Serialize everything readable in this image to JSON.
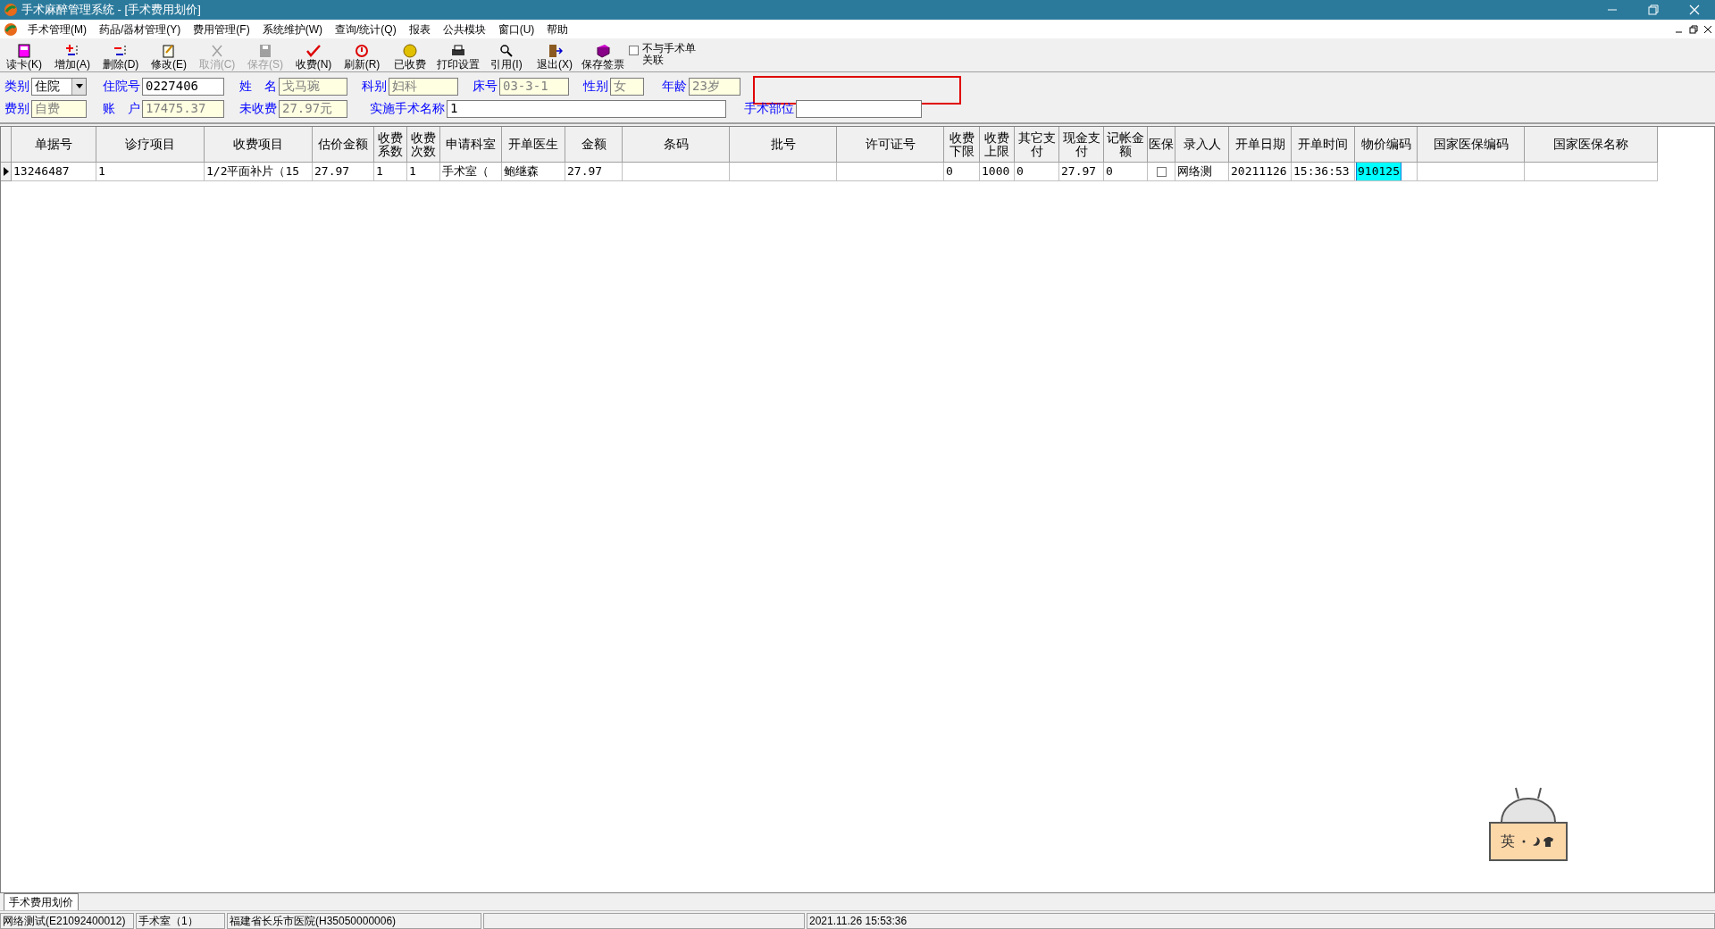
{
  "window": {
    "title": "手术麻醉管理系统 - [手术费用划价]"
  },
  "menu": [
    "手术管理(M)",
    "药品/器材管理(Y)",
    "费用管理(F)",
    "系统维护(W)",
    "查询/统计(Q)",
    "报表",
    "公共模块",
    "窗口(U)",
    "帮助"
  ],
  "toolbar": [
    {
      "label": "读卡(K)",
      "disabled": false
    },
    {
      "label": "增加(A)",
      "disabled": false
    },
    {
      "label": "删除(D)",
      "disabled": false
    },
    {
      "label": "修改(E)",
      "disabled": false
    },
    {
      "label": "取消(C)",
      "disabled": true
    },
    {
      "label": "保存(S)",
      "disabled": true
    },
    {
      "label": "收费(N)",
      "disabled": false
    },
    {
      "label": "刷新(R)",
      "disabled": false
    },
    {
      "label": "已收费",
      "disabled": false
    },
    {
      "label": "打印设置",
      "disabled": false
    },
    {
      "label": "引用(I)",
      "disabled": false
    },
    {
      "label": "退出(X)",
      "disabled": false
    },
    {
      "label": "保存签票",
      "disabled": false
    }
  ],
  "unlink_checkbox": {
    "label": "不与手术单关联",
    "checked": false
  },
  "form_row_1": [
    {
      "label": "类别",
      "value": "住院",
      "kind": "combo",
      "readonly": false
    },
    {
      "label": "住院号",
      "value": "0227406",
      "kind": "text",
      "readonly": false
    },
    {
      "label": "姓　名",
      "value": "戈马琬",
      "kind": "text",
      "readonly": true
    },
    {
      "label": "科别",
      "value": "妇科",
      "kind": "text",
      "readonly": true
    },
    {
      "label": "床号",
      "value": "03-3-1",
      "kind": "text",
      "readonly": true
    },
    {
      "label": "性别",
      "value": "女",
      "kind": "text",
      "readonly": true
    },
    {
      "label": "年龄",
      "value": "23岁",
      "kind": "text",
      "readonly": true
    }
  ],
  "form_row_2": [
    {
      "label": "费别",
      "value": "自费",
      "kind": "text",
      "readonly": true
    },
    {
      "label": "账　户",
      "value": "17475.37",
      "kind": "text",
      "readonly": true
    },
    {
      "label": "未收费",
      "value": "27.97元",
      "kind": "text",
      "readonly": true
    },
    {
      "label": "实施手术名称",
      "value": "1",
      "kind": "text",
      "readonly": false
    },
    {
      "label": "手术部位",
      "kind": "text",
      "readonly": false
    }
  ],
  "table": {
    "columns": [
      "单据号",
      "诊疗项目",
      "收费项目",
      "估价金额",
      "收费系数",
      "收费次数",
      "申请科室",
      "开单医生",
      "金额",
      "条码",
      "批号",
      "许可证号",
      "收费下限",
      "收费上限",
      "其它支付",
      "现金支付",
      "记帐金额",
      "医保",
      "录入人",
      "开单日期",
      "开单时间",
      "物价编码",
      "国家医保编码",
      "国家医保名称"
    ],
    "rows": [
      {
        "selected": true,
        "cells": [
          {
            "text": "13246487",
            "selected": false
          },
          {
            "text": "1",
            "selected": false
          },
          {
            "text": "1/2平面补片（15",
            "selected": false
          },
          {
            "text": "27.97",
            "selected": false
          },
          {
            "text": "1",
            "selected": false
          },
          {
            "text": "1",
            "selected": false
          },
          {
            "text": "手术室（",
            "selected": false
          },
          {
            "text": "鲍继森",
            "selected": false
          },
          {
            "text": "27.97",
            "selected": false
          },
          {},
          {},
          {},
          {
            "text": "0",
            "selected": false
          },
          {
            "text": "1000",
            "selected": false
          },
          {
            "text": "0",
            "selected": false
          },
          {
            "text": "27.97",
            "selected": false
          },
          {
            "text": "0",
            "selected": false
          },
          {
            "kind": "checkbox",
            "checked": false
          },
          {
            "text": "网络测",
            "selected": false
          },
          {
            "text": "20211126",
            "selected": false
          },
          {
            "text": "15:36:53",
            "selected": false
          },
          {
            "text": "910125",
            "selected": true
          },
          {},
          {}
        ]
      }
    ]
  },
  "window_tabs": [
    {
      "label": "手术费用划价",
      "selected": true
    }
  ],
  "status_bar": [
    {
      "text": "网络测试(E21092400012)"
    },
    {
      "text": "手术室（1）"
    },
    {
      "text": "福建省长乐市医院(H35050000006)"
    },
    {
      "text": "2021.11.26 15:53:36"
    }
  ],
  "ime_widget": {
    "label": "英"
  }
}
